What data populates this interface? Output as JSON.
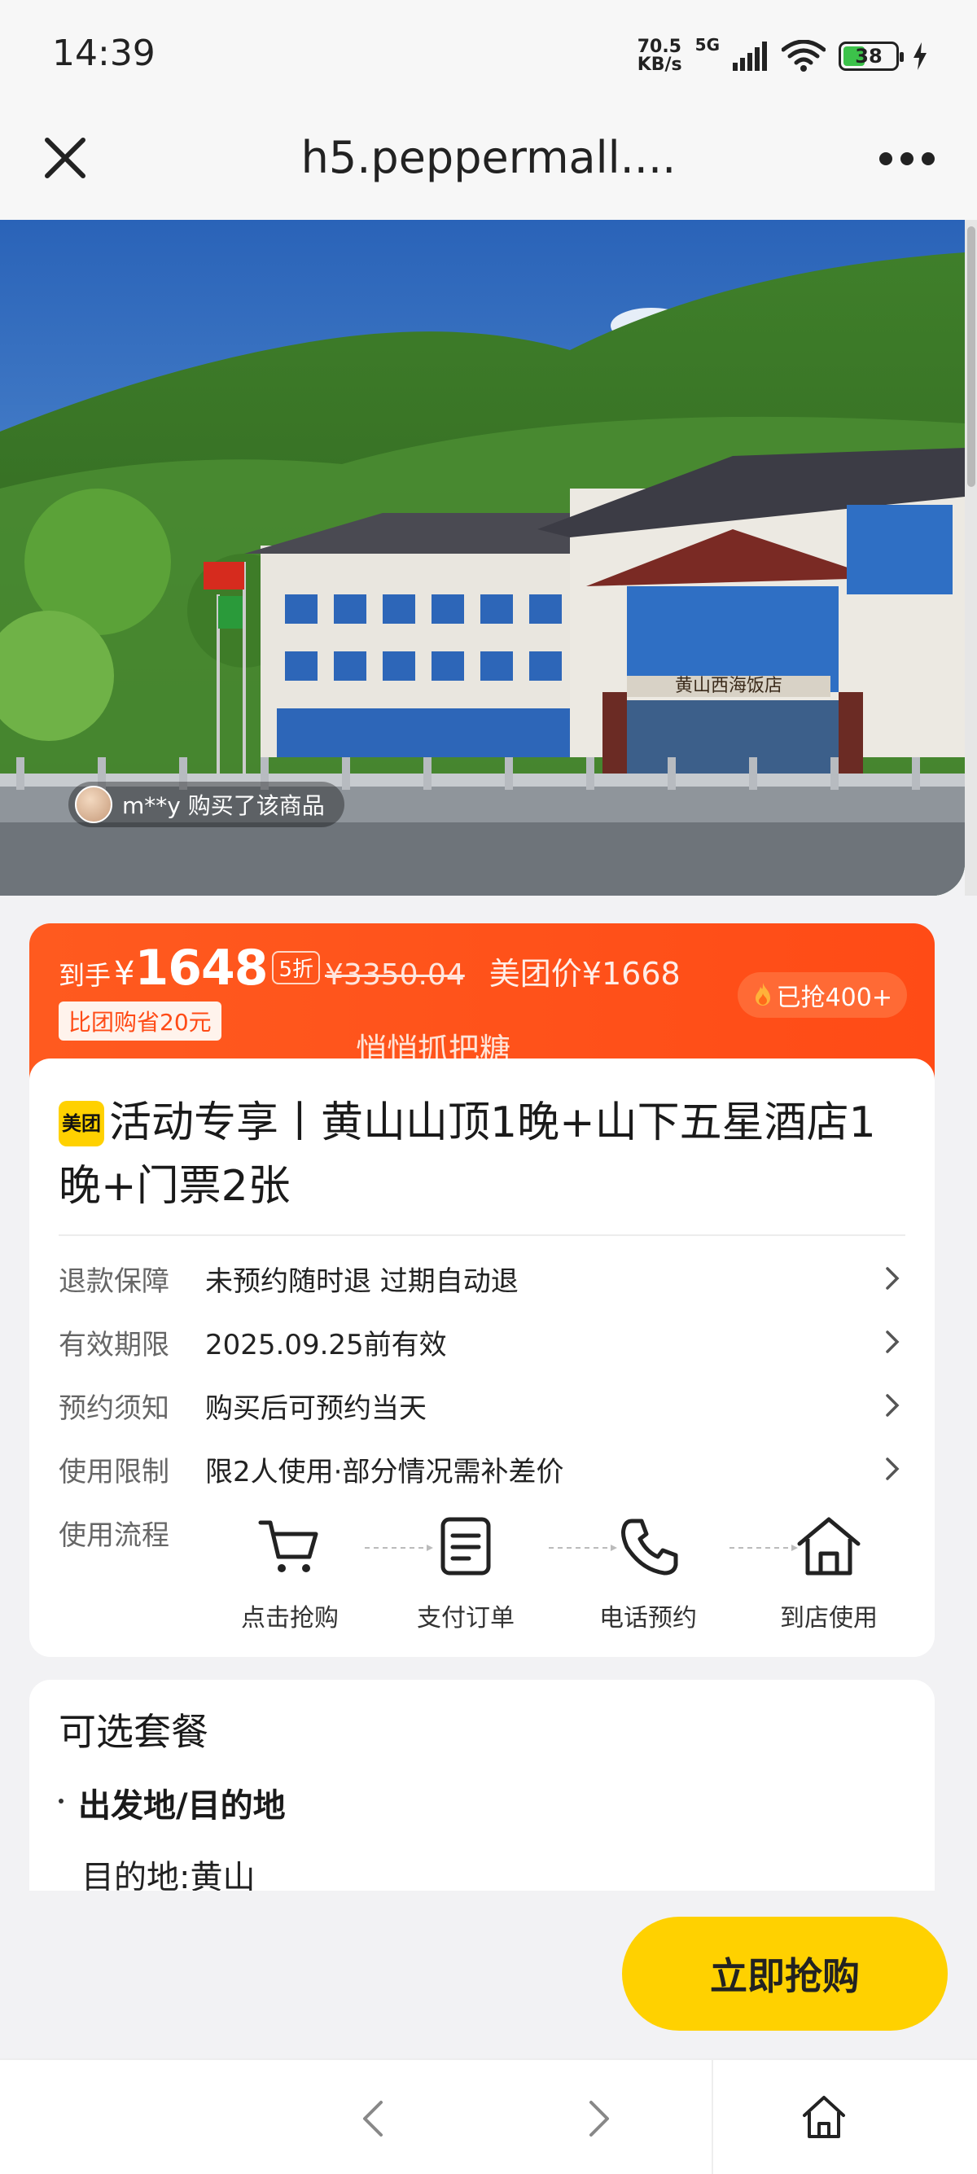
{
  "status_bar": {
    "time": "14:39",
    "net_speed_value": "70.5",
    "net_speed_unit": "KB/s",
    "network": "5G",
    "battery": "38"
  },
  "top_nav": {
    "title": "h5.peppermall...."
  },
  "hero": {
    "buyer_text": "m**y 购买了该商品",
    "sign_text": "黄山西海饭店"
  },
  "price": {
    "label": "到手",
    "currency": "¥",
    "amount": "1648",
    "discount": "5折",
    "original": "¥3350.04",
    "meituan_price": "美团价¥1668",
    "save_badge": "比团购省20元",
    "sold": "已抢400+",
    "banner_text": "悄悄抓把糖"
  },
  "product": {
    "logo": "美团",
    "title": "活动专享丨黄山山顶1晚+山下五星酒店1晚+门票2张",
    "details": [
      {
        "label": "退款保障",
        "value": "未预约随时退 过期自动退"
      },
      {
        "label": "有效期限",
        "value": "2025.09.25前有效"
      },
      {
        "label": "预约须知",
        "value": "购买后可预约当天"
      },
      {
        "label": "使用限制",
        "value": "限2人使用·部分情况需补差价"
      }
    ],
    "flow_label": "使用流程",
    "flow_steps": [
      {
        "label": "点击抢购",
        "icon": "cart-icon"
      },
      {
        "label": "支付订单",
        "icon": "document-icon"
      },
      {
        "label": "电话预约",
        "icon": "phone-icon"
      },
      {
        "label": "到店使用",
        "icon": "home-icon"
      }
    ]
  },
  "package": {
    "title": "可选套餐",
    "section": "出发地/目的地",
    "destination": "目的地:黄山"
  },
  "cta": {
    "buy_label": "立即抢购"
  },
  "colors": {
    "accent": "#ff4b16",
    "cta": "#ffd100"
  }
}
